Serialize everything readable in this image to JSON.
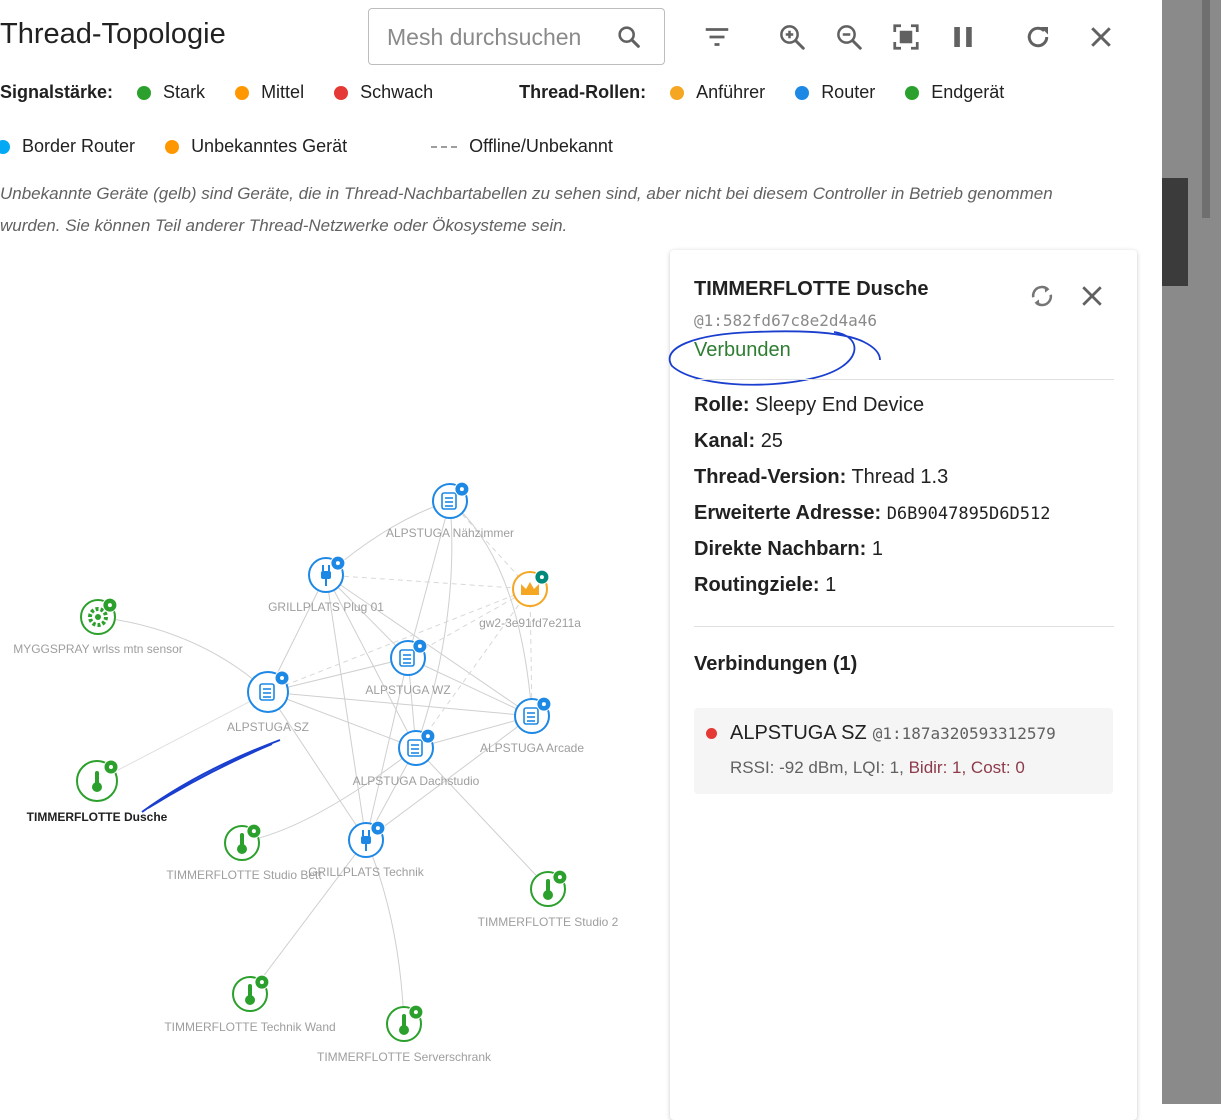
{
  "header": {
    "title": "Thread-Topologie",
    "search_placeholder": "Mesh durchsuchen"
  },
  "legend": {
    "signal_label": "Signalstärke:",
    "signal_items": [
      {
        "label": "Stark",
        "color": "#2ca02c"
      },
      {
        "label": "Mittel",
        "color": "#ff9800"
      },
      {
        "label": "Schwach",
        "color": "#e53935"
      }
    ],
    "roles_label": "Thread-Rollen:",
    "role_items": [
      {
        "label": "Anführer",
        "color": "#f5a623"
      },
      {
        "label": "Router",
        "color": "#1e88e5"
      },
      {
        "label": "Endgerät",
        "color": "#2ca02c"
      }
    ],
    "row2_items": [
      {
        "label": "Border Router",
        "color": "#03a9f4"
      },
      {
        "label": "Unbekanntes Gerät",
        "color": "#ff9800"
      }
    ],
    "offline_label": "Offline/Unbekannt"
  },
  "note": "Unbekannte Geräte (gelb) sind Geräte, die in Thread-Nachbartabellen zu sehen sind, aber nicht bei diesem Controller in Betrieb genommen wurden. Sie können Teil anderer Thread-Netzwerke oder Ökosysteme sein.",
  "panel": {
    "title": "TIMMERFLOTTE Dusche",
    "id": "@1:582fd67c8e2d4a46",
    "status": "Verbunden",
    "status_color": "#2e7d32",
    "properties": [
      {
        "label": "Rolle:",
        "value": "Sleepy End Device",
        "mono": false
      },
      {
        "label": "Kanal:",
        "value": "25",
        "mono": false
      },
      {
        "label": "Thread-Version:",
        "value": "Thread 1.3",
        "mono": false
      },
      {
        "label": "Erweiterte Adresse:",
        "value": "D6B9047895D6D512",
        "mono": true
      },
      {
        "label": "Direkte Nachbarn:",
        "value": "1",
        "mono": false
      },
      {
        "label": "Routingziele:",
        "value": "1",
        "mono": false
      }
    ],
    "connections_title": "Verbindungen (1)",
    "connection": {
      "name": "ALPSTUGA SZ",
      "address": "@1:187a320593312579",
      "rssi": "RSSI: -92 dBm, LQI: 1,",
      "bidir": "Bidir: 1, Cost: 0"
    }
  },
  "graph": {
    "nodes": [
      {
        "id": "naeh",
        "label": "ALPSTUGA Nähzimmer",
        "type": "router-sensor",
        "color": "#1e88e5"
      },
      {
        "id": "plug01",
        "label": "GRILLPLATS Plug 01",
        "type": "router-plug",
        "color": "#1e88e5"
      },
      {
        "id": "gw2",
        "label": "gw2-3e91fd7e211a",
        "type": "leader",
        "color": "#f5a623"
      },
      {
        "id": "myggspray",
        "label": "MYGGSPRAY wrlss mtn sensor",
        "type": "end-gear",
        "color": "#2ca02c"
      },
      {
        "id": "wz",
        "label": "ALPSTUGA WZ",
        "type": "router-sensor",
        "color": "#1e88e5"
      },
      {
        "id": "sz",
        "label": "ALPSTUGA SZ",
        "type": "router-sensor",
        "color": "#1e88e5"
      },
      {
        "id": "arcade",
        "label": "ALPSTUGA Arcade",
        "type": "router-sensor",
        "color": "#1e88e5"
      },
      {
        "id": "dach",
        "label": "ALPSTUGA Dachstudio",
        "type": "router-sensor",
        "color": "#1e88e5"
      },
      {
        "id": "dusche",
        "label": "TIMMERFLOTTE Dusche",
        "type": "end-thermo",
        "color": "#2ca02c",
        "selected": true
      },
      {
        "id": "bett",
        "label": "TIMMERFLOTTE Studio Bett",
        "type": "end-thermo",
        "color": "#2ca02c"
      },
      {
        "id": "technik",
        "label": "GRILLPLATS Technik",
        "type": "router-plug",
        "color": "#1e88e5"
      },
      {
        "id": "studio2",
        "label": "TIMMERFLOTTE Studio 2",
        "type": "end-thermo",
        "color": "#2ca02c"
      },
      {
        "id": "wand",
        "label": "TIMMERFLOTTE Technik Wand",
        "type": "end-thermo",
        "color": "#2ca02c"
      },
      {
        "id": "server",
        "label": "TIMMERFLOTTE Serverschrank",
        "type": "end-thermo",
        "color": "#2ca02c"
      }
    ]
  }
}
